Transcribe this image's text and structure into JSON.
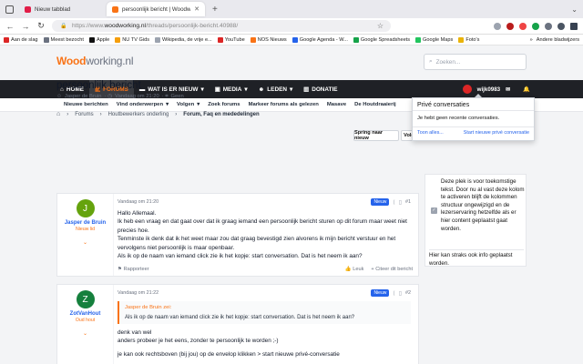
{
  "browser": {
    "tabs": [
      {
        "title": "Nieuw tabblad",
        "favicon_color": "#e11d48"
      },
      {
        "title": "persoonlijk bericht | Woodworking.nl",
        "favicon_color": "#f97316"
      }
    ],
    "url_prefix": "https://www.",
    "url_domain": "woodworking.nl",
    "url_path": "/threads/persoonlijk-bericht.40988/",
    "bookmarks": [
      "Aan de slag",
      "Meest bezocht",
      "Apple",
      "NU TV Gids",
      "Wikipedia, de vrije e...",
      "YouTube",
      "NOS Nieuws",
      "Google Agenda - W...",
      "Google Spreadsheets",
      "Google Maps",
      "Foto's"
    ],
    "bookmarks_other": "Andere bladwijzers"
  },
  "site": {
    "logo_main": "Wood",
    "logo_rest": "working.nl",
    "search_placeholder": "Zoeken..."
  },
  "nav": {
    "items": [
      "HOME",
      "FORUMS",
      "WAT IS ER NIEUW",
      "MEDIA",
      "LEDEN",
      "DONATIE"
    ],
    "username": "wijk0983"
  },
  "subnav": [
    "Nieuwe berichten",
    "Vind onderwerpen",
    "Volgen",
    "Zoek forums",
    "Markeer forums als gelezen",
    "Masave",
    "De Houtdraaierij"
  ],
  "thread": {
    "title": "persoonlijk bericht",
    "author": "Jasper de Bruin",
    "date": "Vandaag om 21:20",
    "tags": "Geen"
  },
  "breadcrumbs": [
    "Forums",
    "Houtbewerkers onderling",
    "Forum, Faq en mededelingen"
  ],
  "buttons": {
    "sort_new": "Spring naar nieuw",
    "follow": "Volg"
  },
  "posts": [
    {
      "initial": "J",
      "avatar_color": "#65a30d",
      "user": "Jasper de Bruin",
      "role": "Nieuw lid",
      "date": "Vandaag om 21:20",
      "badge": "Nieuw",
      "num": "#1",
      "lines": [
        "Hallo Allemaal.",
        "Ik heb een vraag en dat gaat over dat ik graag iemand een persoonlijk bericht sturen op dit forum maar weet niet precies hoe.",
        "Tenminste ik denk dat ik het weet maar zou dat graag bevestigd zien alvorens ik mijn bericht verstuur en het vervolgens niet persoonlijk is maar openbaar.",
        "Als ik op de naam van iemand click zie ik het kopje: start conversation. Dat is het neem ik aan?"
      ],
      "report": "Rapporteer",
      "like": "Leuk",
      "quote": "Citeer dit bericht"
    },
    {
      "initial": "Z",
      "avatar_color": "#15803d",
      "user": "ZotVanHout",
      "role": "Oud hout",
      "date": "Vandaag om 21:22",
      "badge": "Nieuw",
      "num": "#2",
      "quote_author": "Jasper de Bruin zei:",
      "quote_text": "Als ik op de naam van iemand click zie ik het kopje: start conversation. Dat is het neem ik aan?",
      "lines": [
        "denk van wel",
        "anders probeer je het eens, zonder te persoonlijk te worden ;-)",
        "je kan ook rechtsboven (bij jou) op de envelop klikken > start nieuwe privé-conversatie"
      ]
    }
  ],
  "sidebar": {
    "text": "Deze plek is voor toekomstige tekst. Door nu al vast deze kolom te activeren blijft de kolommen structuur ongewijzigd en de lezerservaring hetzelfde als er hier content geplaatst gaat worden.",
    "text2": "Hier kan straks ook info geplaatst worden."
  },
  "popup": {
    "title": "Privé conversaties",
    "empty": "Je hebt geen recente conversaties.",
    "show_all": "Toon alles...",
    "start_new": "Start nieuwe privé conversatie"
  }
}
